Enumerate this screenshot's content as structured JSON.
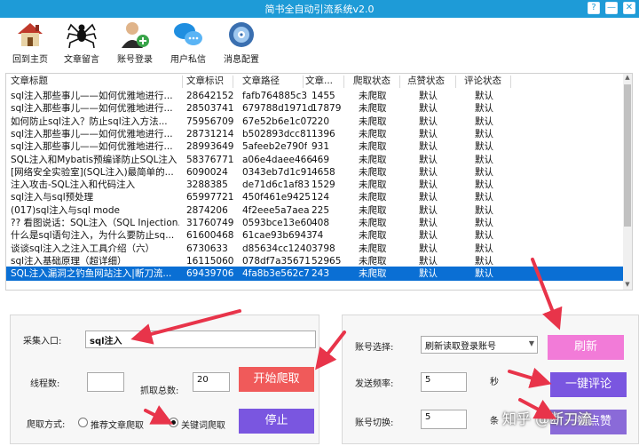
{
  "window": {
    "title": "简书全自动引流系统v2.0",
    "btn_help": "?",
    "btn_min": "—",
    "btn_close": "✕"
  },
  "toolbar": [
    {
      "label": "回到主页",
      "icon": "house-icon"
    },
    {
      "label": "文章留言",
      "icon": "spider-icon"
    },
    {
      "label": "账号登录",
      "icon": "user-add-icon"
    },
    {
      "label": "用户私信",
      "icon": "chat-bubbles-icon"
    },
    {
      "label": "消息配置",
      "icon": "gear-cd-icon"
    }
  ],
  "table": {
    "headers": [
      "文章标题",
      "文章标识",
      "文章路径",
      "文章...",
      "爬取状态",
      "点赞状态",
      "评论状态"
    ],
    "rows": [
      [
        "sql注入那些事儿——如何优雅地进行...",
        "28642152",
        "fafb764885c3",
        "1455",
        "未爬取",
        "默认",
        "默认"
      ],
      [
        "sql注入那些事儿——如何优雅地进行...",
        "28503741",
        "679788d1971d",
        "17879",
        "未爬取",
        "默认",
        "默认"
      ],
      [
        "如何防止sql注入？防止sql注入方法...",
        "75956709",
        "67e52b6e1c07",
        "220",
        "未爬取",
        "默认",
        "默认"
      ],
      [
        "sql注入那些事儿——如何优雅地进行...",
        "28731214",
        "b502893dcc81",
        "1396",
        "未爬取",
        "默认",
        "默认"
      ],
      [
        "sql注入那些事儿——如何优雅地进行...",
        "28993649",
        "5afeeb2e790f",
        "931",
        "未爬取",
        "默认",
        "默认"
      ],
      [
        "SQL注入和Mybatis预编译防止SQL注入",
        "58376771",
        "a06e4daee466",
        "469",
        "未爬取",
        "默认",
        "默认"
      ],
      [
        "[网络安全实验室](SQL注入)最简单的...",
        "6090024",
        "0343eb7d1c91",
        "4658",
        "未爬取",
        "默认",
        "默认"
      ],
      [
        "注入攻击-SQL注入和代码注入",
        "3288385",
        "de71d6c1af83",
        "1529",
        "未爬取",
        "默认",
        "默认"
      ],
      [
        "sql注入与sql预处理",
        "65997721",
        "450f461e9425",
        "124",
        "未爬取",
        "默认",
        "默认"
      ],
      [
        "(017)sql注入与sql mode",
        "2874206",
        "4f2eee5a7aea",
        "225",
        "未爬取",
        "默认",
        "默认"
      ],
      [
        "?? 看图说话：SQL注入（SQL Injection...",
        "31760749",
        "0593bce13e60",
        "408",
        "未爬取",
        "默认",
        "默认"
      ],
      [
        "什么是sql语句注入，为什么要防止sq...",
        "61600468",
        "61cae93b6943",
        "74",
        "未爬取",
        "默认",
        "默认"
      ],
      [
        "谈谈sql注入之注入工具介绍（六）",
        "6730633",
        "d85634cc1240",
        "3798",
        "未爬取",
        "默认",
        "默认"
      ],
      [
        "sql注入基础原理（超详细）",
        "16115060",
        "078df7a35671",
        "52965",
        "未爬取",
        "默认",
        "默认"
      ],
      [
        "SQL注入漏洞之钓鱼网站注入|断刀流...",
        "69439706",
        "4fa8b3e562c7",
        "243",
        "未爬取",
        "默认",
        "默认"
      ]
    ],
    "selected_index": 14
  },
  "left_panel": {
    "collect_entry_label": "采集入口:",
    "collect_entry_value": "sql注入",
    "threads_label": "线程数:",
    "threads_value": "",
    "total_label": "抓取总数:",
    "total_value": "20",
    "start_button": "开始爬取",
    "stop_button": "停止",
    "mode_label": "爬取方式:",
    "mode_option_recommend": "推荐文章爬取",
    "mode_option_keyword": "关键词爬取",
    "mode_selected": "keyword"
  },
  "right_panel": {
    "account_label": "账号选择:",
    "account_value": "刷新读取登录账号",
    "refresh_button": "刷新",
    "freq_label": "发送频率:",
    "freq_value": "5",
    "freq_unit": "秒",
    "comment_button": "一键评论",
    "switch_label": "账号切换:",
    "switch_value": "5",
    "switch_unit": "条",
    "like_button": "一键点赞"
  },
  "watermark": "知乎 @断刀流",
  "colors": {
    "titlebar": "#1e9bd7",
    "selected_row": "#0a6fd4",
    "red_btn": "#f05a5a",
    "purple_btn": "#7a56e0",
    "pink_btn": "#f27bd8",
    "arrow": "#e8344a"
  }
}
